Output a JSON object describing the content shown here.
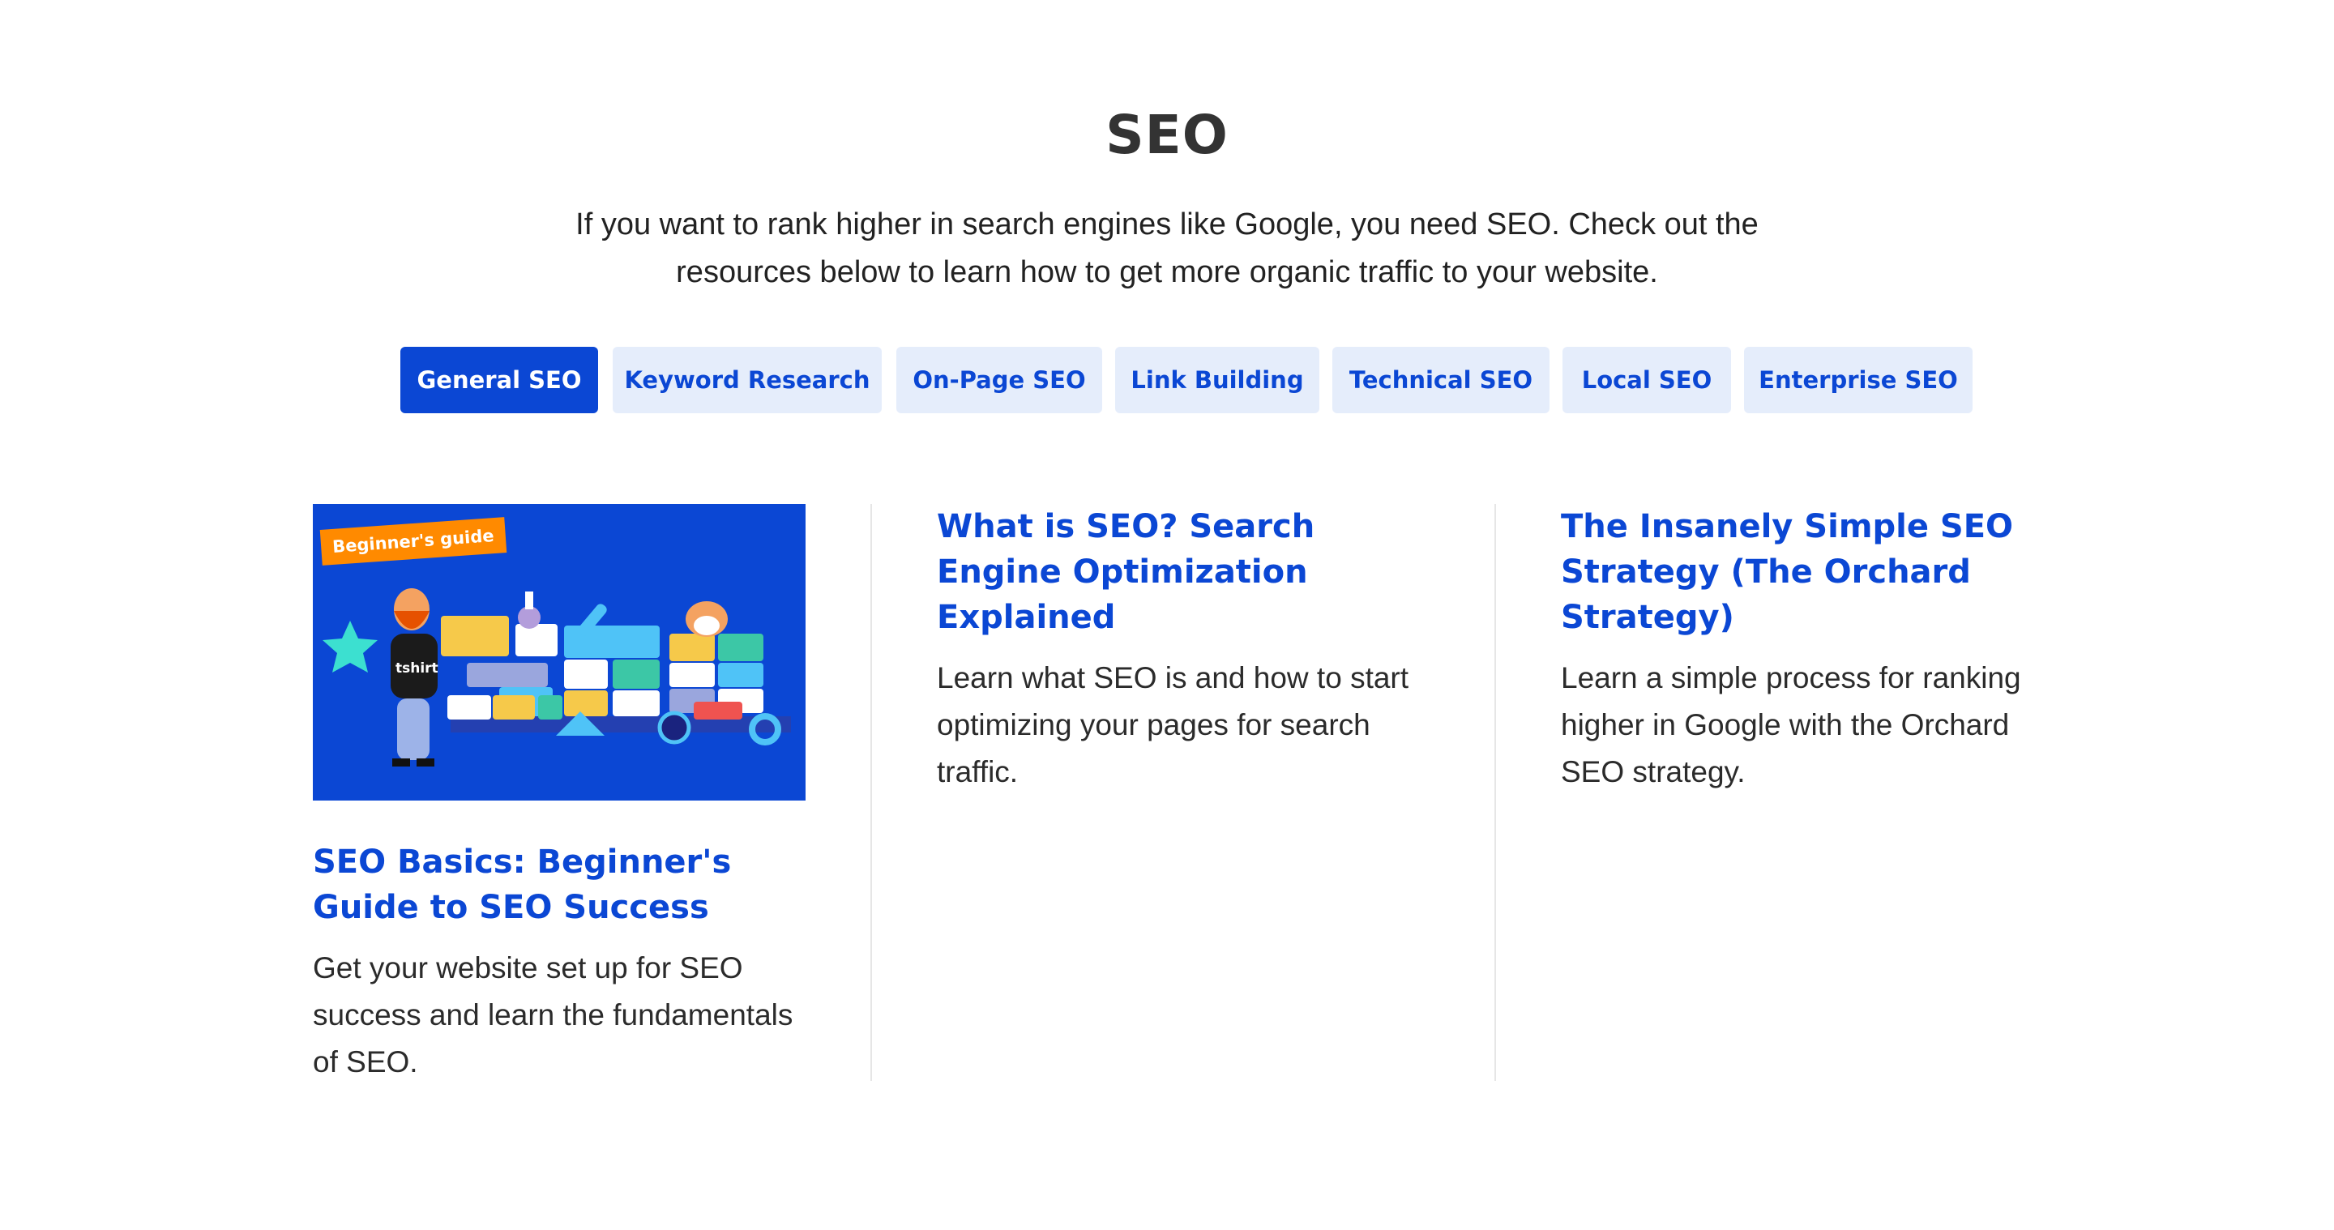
{
  "section": {
    "title": "SEO",
    "intro": "If you want to rank higher in search engines like Google, you need SEO. Check out the resources below to learn how to get more organic traffic to your website."
  },
  "tabs": [
    {
      "label": "General SEO",
      "active": true
    },
    {
      "label": "Keyword Research",
      "active": false
    },
    {
      "label": "On-Page SEO",
      "active": false
    },
    {
      "label": "Link Building",
      "active": false
    },
    {
      "label": "Technical SEO",
      "active": false
    },
    {
      "label": "Local SEO",
      "active": false
    },
    {
      "label": "Enterprise SEO",
      "active": false
    }
  ],
  "cards": [
    {
      "image_badge": "Beginner's guide",
      "image_shirt_text": "tshirt",
      "title": "SEO Basics: Beginner's Guide to SEO Success",
      "description": "Get your website set up for SEO success and learn the fundamentals of SEO."
    },
    {
      "title": "What is SEO? Search Engine Optimization Explained",
      "description": "Learn what SEO is and how to start optimizing your pages for search traffic."
    },
    {
      "title": "The Insanely Simple SEO Strategy (The Orchard Strategy)",
      "description": "Learn a simple process for ranking higher in Google with the Orchard SEO strategy."
    }
  ],
  "colors": {
    "accent": "#0b47d4",
    "tab_bg": "#e5edfb",
    "badge": "#ff8a00"
  }
}
